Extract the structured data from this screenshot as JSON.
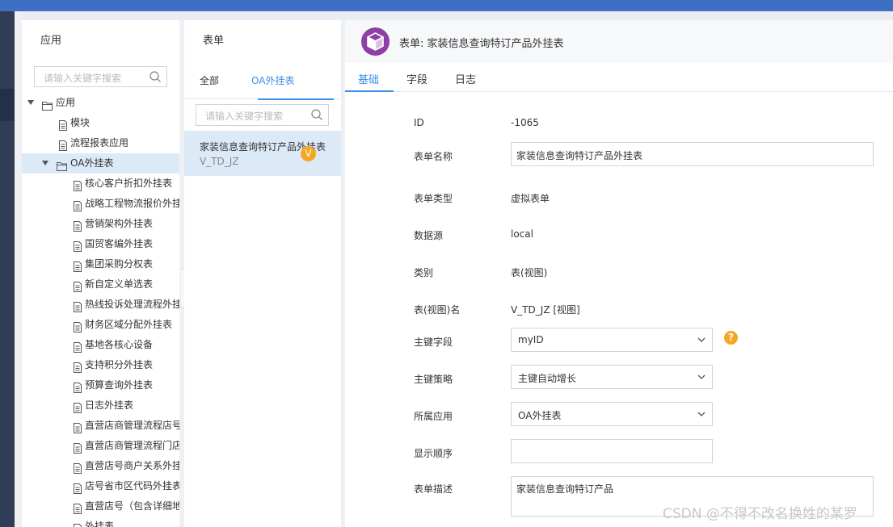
{
  "app_panel": {
    "header": "应用",
    "search_placeholder": "请输入关键字搜索",
    "tree": [
      {
        "label": "应用",
        "level": 0,
        "kind": "folder",
        "expanded": true
      },
      {
        "label": "模块",
        "level": 1,
        "kind": "file"
      },
      {
        "label": "流程报表应用",
        "level": 1,
        "kind": "file"
      },
      {
        "label": "OA外挂表",
        "level": 1,
        "kind": "folder",
        "expanded": true,
        "selected": true
      },
      {
        "label": "核心客户折扣外挂表",
        "level": 2,
        "kind": "file"
      },
      {
        "label": "战略工程物流报价外挂表",
        "level": 2,
        "kind": "file"
      },
      {
        "label": "营销架构外挂表",
        "level": 2,
        "kind": "file"
      },
      {
        "label": "国贸客编外挂表",
        "level": 2,
        "kind": "file"
      },
      {
        "label": "集团采购分权表",
        "level": 2,
        "kind": "file"
      },
      {
        "label": "新自定义单选表",
        "level": 2,
        "kind": "file"
      },
      {
        "label": "热线投诉处理流程外挂表",
        "level": 2,
        "kind": "file"
      },
      {
        "label": "财务区域分配外挂表",
        "level": 2,
        "kind": "file"
      },
      {
        "label": "基地各核心设备",
        "level": 2,
        "kind": "file"
      },
      {
        "label": "支持积分外挂表",
        "level": 2,
        "kind": "file"
      },
      {
        "label": "预算查询外挂表",
        "level": 2,
        "kind": "file"
      },
      {
        "label": "日志外挂表",
        "level": 2,
        "kind": "file"
      },
      {
        "label": "直营店商管理流程店号",
        "level": 2,
        "kind": "file"
      },
      {
        "label": "直营店商管理流程门店",
        "level": 2,
        "kind": "file"
      },
      {
        "label": "直营店号商户关系外挂",
        "level": 2,
        "kind": "file"
      },
      {
        "label": "店号省市区代码外挂表",
        "level": 2,
        "kind": "file"
      },
      {
        "label": "直营店号（包含详细地",
        "level": 2,
        "kind": "file"
      },
      {
        "label": "外挂表",
        "level": 2,
        "kind": "file"
      }
    ]
  },
  "form_panel": {
    "header": "表单",
    "tabs": [
      "全部",
      "OA外挂表"
    ],
    "active_tab": 1,
    "search_placeholder": "请输入关键字搜索",
    "items": [
      {
        "name": "家装信息查询特订产品外挂表",
        "code": "V_TD_JZ",
        "badge": "V"
      }
    ]
  },
  "detail_panel": {
    "title": "表单: 家装信息查询特订产品外挂表",
    "tabs": [
      "基础",
      "字段",
      "日志"
    ],
    "active_tab": 0,
    "fields": {
      "id_label": "ID",
      "id_value": "-1065",
      "name_label": "表单名称",
      "name_value": "家装信息查询特订产品外挂表",
      "type_label": "表单类型",
      "type_value": "虚拟表单",
      "datasource_label": "数据源",
      "datasource_value": "local",
      "category_label": "类别",
      "category_value": "表(视图)",
      "viewname_label": "表(视图)名",
      "viewname_value": "V_TD_JZ [视图]",
      "pk_label": "主键字段",
      "pk_value": "myID",
      "pk_strategy_label": "主键策略",
      "pk_strategy_value": "主键自动增长",
      "app_label": "所属应用",
      "app_value": "OA外挂表",
      "order_label": "显示顺序",
      "order_value": "",
      "desc_label": "表单描述",
      "desc_value": "家装信息查询特订产品"
    },
    "help_icon": "?"
  },
  "watermark": "CSDN @不得不改名换姓的某罗",
  "colors": {
    "accent": "#3a8ee6",
    "selected_bg": "#dceaf8",
    "badge": "#f5a623",
    "cube": "#8e3fa6",
    "topbar": "#3d6fc4"
  }
}
